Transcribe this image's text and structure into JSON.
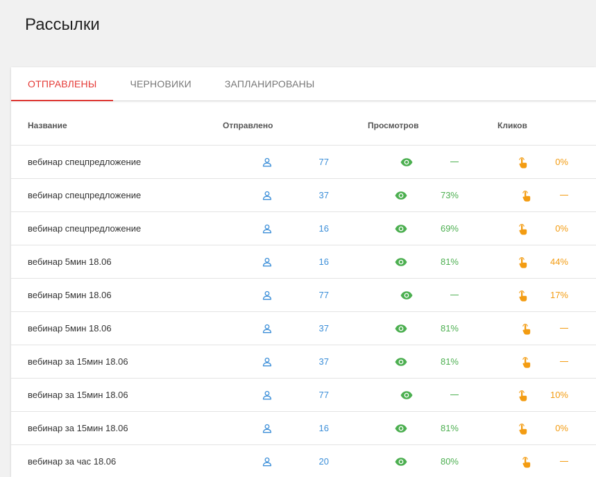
{
  "page": {
    "title": "Рассылки"
  },
  "tabs": [
    {
      "label": "ОТПРАВЛЕНЫ",
      "active": true
    },
    {
      "label": "ЧЕРНОВИКИ",
      "active": false
    },
    {
      "label": "ЗАПЛАНИРОВАНЫ",
      "active": false
    }
  ],
  "columns": {
    "name": "Название",
    "sent": "Отправлено",
    "views": "Просмотров",
    "clicks": "Кликов"
  },
  "colors": {
    "accent": "#e53935",
    "sent": "#3b8ed8",
    "views": "#4caf50",
    "clicks": "#f39c12"
  },
  "icons": {
    "sent": "user-icon",
    "views": "eye-icon",
    "clicks": "pointer-hand-icon",
    "empty": "dash-icon"
  },
  "rows": [
    {
      "name": "вебинар спецпредложение",
      "sent": "77",
      "views": null,
      "clicks": "0%"
    },
    {
      "name": "вебинар спецпредложение",
      "sent": "37",
      "views": "73%",
      "clicks": null
    },
    {
      "name": "вебинар спецпредложение",
      "sent": "16",
      "views": "69%",
      "clicks": "0%"
    },
    {
      "name": "вебинар 5мин 18.06",
      "sent": "16",
      "views": "81%",
      "clicks": "44%"
    },
    {
      "name": "вебинар 5мин 18.06",
      "sent": "77",
      "views": null,
      "clicks": "17%"
    },
    {
      "name": "вебинар 5мин 18.06",
      "sent": "37",
      "views": "81%",
      "clicks": null
    },
    {
      "name": "вебинар за 15мин 18.06",
      "sent": "37",
      "views": "81%",
      "clicks": null
    },
    {
      "name": "вебинар за 15мин 18.06",
      "sent": "77",
      "views": null,
      "clicks": "10%"
    },
    {
      "name": "вебинар за 15мин 18.06",
      "sent": "16",
      "views": "81%",
      "clicks": "0%"
    },
    {
      "name": "вебинар за час 18.06",
      "sent": "20",
      "views": "80%",
      "clicks": null
    }
  ]
}
